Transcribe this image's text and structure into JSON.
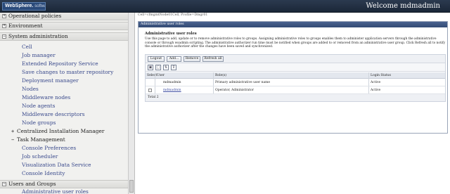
{
  "banner": {
    "logo_brand": "WebSphere.",
    "logo_suffix": "software",
    "welcome": "Welcome mdmadmin"
  },
  "nav": {
    "categories": [
      {
        "label": "Operational policies",
        "expanded": false
      },
      {
        "label": "Environment",
        "expanded": false
      },
      {
        "label": "System administration",
        "expanded": true
      },
      {
        "label": "Users and Groups",
        "expanded": true
      }
    ],
    "system_admin_items": [
      "Cell",
      "Job manager",
      "Extended Repository Service",
      "Save changes to master repository",
      "Deployment manager",
      "Nodes",
      "Middleware nodes",
      "Node agents",
      "Middleware descriptors",
      "Node groups"
    ],
    "subgroups": [
      {
        "label": "Centralized Installation Manager",
        "expanded": false
      },
      {
        "label": "Task Management",
        "expanded": true
      }
    ],
    "task_items": [
      "Console Preferences",
      "Job scheduler",
      "Visualization Data Service",
      "Console Identity"
    ],
    "users_groups_items": [
      "Administrative user roles"
    ]
  },
  "content": {
    "breadcrumb": "Cell=cfmgmtNode01Cell, Profile=Dmgr01",
    "panel_header": "Administrative user roles",
    "title": "Administrative user roles",
    "description": "Use this page to add, update or to remove administrative roles to groups. Assigning administrative roles to groups enables them to administer application servers through the administrative console or through wsadmin scripting. The administrative authorizer run time must be notified when groups are added to or removed from an administrative user group. Click Refresh all to notify the administrative authorizer after the changes have been saved and synchronized.",
    "buttons": [
      "Logout",
      "Add...",
      "Remove",
      "Refresh all"
    ],
    "icons": [
      "select-all-icon",
      "deselect-all-icon",
      "sort-icon",
      "filter-icon"
    ],
    "columns": [
      "Select",
      "User",
      "Role(s)",
      "Login Status"
    ],
    "rows": [
      {
        "user": "mdmadmin",
        "roles": "Primary administrative user name",
        "status": "Active",
        "selectable": false,
        "link": false
      },
      {
        "user": "mdmadmin",
        "roles": "Operator, Administrator",
        "status": "Active",
        "selectable": true,
        "link": true
      }
    ],
    "total": "Total 2"
  }
}
